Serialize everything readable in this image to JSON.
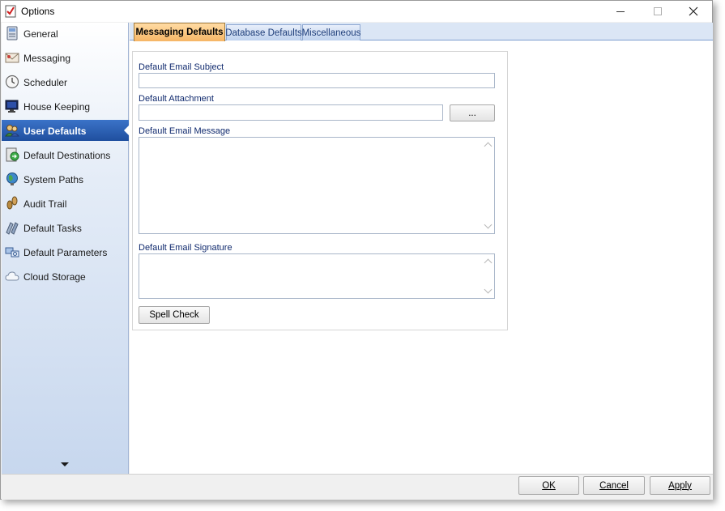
{
  "window": {
    "title": "Options",
    "icon": "checklist-app-icon"
  },
  "sidebar": {
    "items": [
      {
        "label": "General",
        "icon": "general-icon"
      },
      {
        "label": "Messaging",
        "icon": "messaging-icon"
      },
      {
        "label": "Scheduler",
        "icon": "clock-icon"
      },
      {
        "label": "House Keeping",
        "icon": "monitor-icon"
      },
      {
        "label": "User Defaults",
        "icon": "users-icon",
        "selected": true
      },
      {
        "label": "Default Destinations",
        "icon": "destinations-icon"
      },
      {
        "label": "System Paths",
        "icon": "globe-icon"
      },
      {
        "label": "Audit Trail",
        "icon": "footprints-icon"
      },
      {
        "label": "Default Tasks",
        "icon": "tasks-icon"
      },
      {
        "label": "Default Parameters",
        "icon": "parameters-icon"
      },
      {
        "label": "Cloud Storage",
        "icon": "cloud-icon"
      }
    ]
  },
  "tabs": [
    {
      "label": "Messaging Defaults",
      "active": true
    },
    {
      "label": "Database Defaults",
      "active": false
    },
    {
      "label": "Miscellaneous",
      "active": false
    }
  ],
  "form": {
    "email_subject_label": "Default Email Subject",
    "email_subject_value": "",
    "attachment_label": "Default Attachment",
    "attachment_value": "",
    "browse_label": "...",
    "email_message_label": "Default Email Message",
    "email_message_value": "",
    "email_signature_label": "Default Email Signature",
    "email_signature_value": "",
    "spell_check_label": "Spell Check"
  },
  "footer": {
    "ok_label": "OK",
    "cancel_label": "Cancel",
    "apply_label": "Apply"
  },
  "colors": {
    "selected_item": "#2b5fb3",
    "active_tab": "#f8c27a",
    "label_text": "#102a6e"
  }
}
